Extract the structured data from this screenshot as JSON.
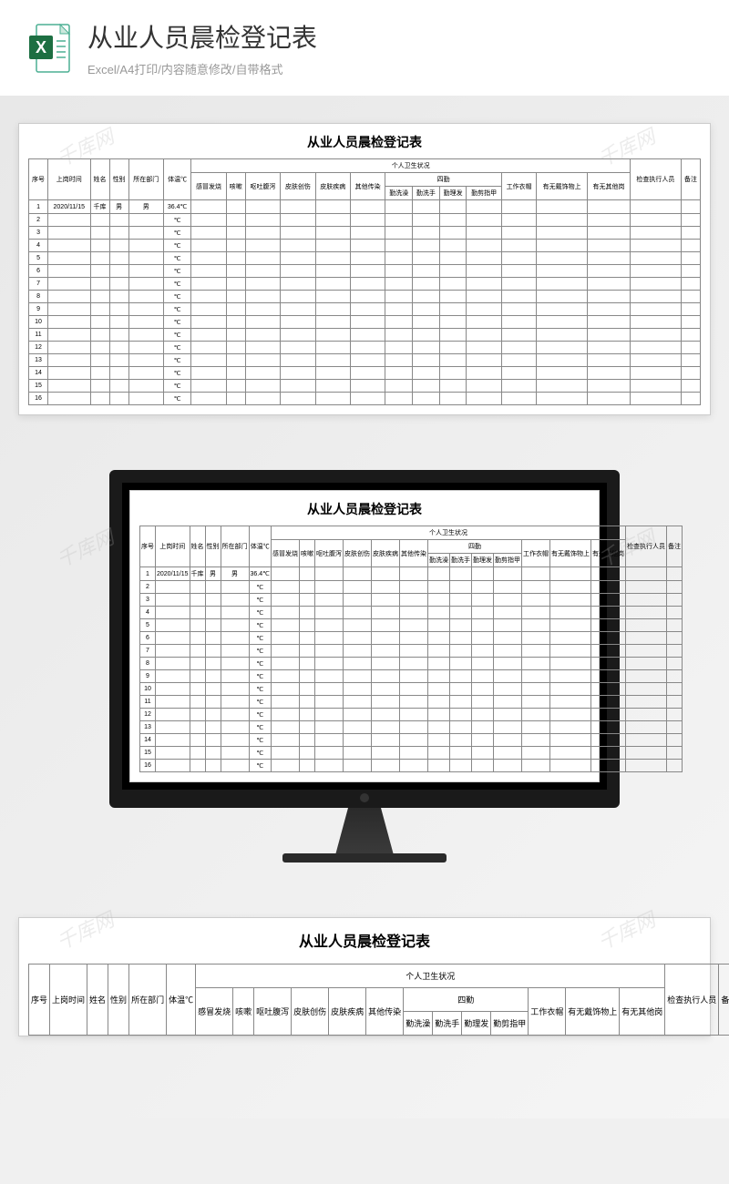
{
  "header": {
    "title": "从业人员晨检登记表",
    "subtitle": "Excel/A4打印/内容随意修改/自带格式"
  },
  "watermark": "千库网",
  "sheet": {
    "title": "从业人员晨检登记表",
    "group_header": "个人卫生状况",
    "sub_group": "四勤",
    "columns": {
      "seq": "序号",
      "date": "上岗时间",
      "name": "姓名",
      "gender": "性别",
      "dept": "所在部门",
      "temp": "体温℃",
      "cold": "感冒发烧",
      "cough": "咳嗽",
      "vomit": "呕吐腹泻",
      "wound": "皮肤创伤",
      "skin": "皮肤疾病",
      "other_inf": "其他传染",
      "bath": "勤洗澡",
      "wash": "勤洗手",
      "hair": "勤理发",
      "nail": "勤剪指甲",
      "uniform": "工作衣帽",
      "jewelry": "有无戴饰物上",
      "other_sit": "有无其他岗",
      "inspector": "检查执行人员",
      "remark": "备注"
    },
    "rows": [
      {
        "seq": "1",
        "date": "2020/11/15",
        "name": "千库",
        "gender": "男",
        "dept": "男",
        "temp": "36.4℃"
      },
      {
        "seq": "2",
        "date": "",
        "name": "",
        "gender": "",
        "dept": "",
        "temp": "℃"
      },
      {
        "seq": "3",
        "date": "",
        "name": "",
        "gender": "",
        "dept": "",
        "temp": "℃"
      },
      {
        "seq": "4",
        "date": "",
        "name": "",
        "gender": "",
        "dept": "",
        "temp": "℃"
      },
      {
        "seq": "5",
        "date": "",
        "name": "",
        "gender": "",
        "dept": "",
        "temp": "℃"
      },
      {
        "seq": "6",
        "date": "",
        "name": "",
        "gender": "",
        "dept": "",
        "temp": "℃"
      },
      {
        "seq": "7",
        "date": "",
        "name": "",
        "gender": "",
        "dept": "",
        "temp": "℃"
      },
      {
        "seq": "8",
        "date": "",
        "name": "",
        "gender": "",
        "dept": "",
        "temp": "℃"
      },
      {
        "seq": "9",
        "date": "",
        "name": "",
        "gender": "",
        "dept": "",
        "temp": "℃"
      },
      {
        "seq": "10",
        "date": "",
        "name": "",
        "gender": "",
        "dept": "",
        "temp": "℃"
      },
      {
        "seq": "11",
        "date": "",
        "name": "",
        "gender": "",
        "dept": "",
        "temp": "℃"
      },
      {
        "seq": "12",
        "date": "",
        "name": "",
        "gender": "",
        "dept": "",
        "temp": "℃"
      },
      {
        "seq": "13",
        "date": "",
        "name": "",
        "gender": "",
        "dept": "",
        "temp": "℃"
      },
      {
        "seq": "14",
        "date": "",
        "name": "",
        "gender": "",
        "dept": "",
        "temp": "℃"
      },
      {
        "seq": "15",
        "date": "",
        "name": "",
        "gender": "",
        "dept": "",
        "temp": "℃"
      },
      {
        "seq": "16",
        "date": "",
        "name": "",
        "gender": "",
        "dept": "",
        "temp": "℃"
      }
    ]
  }
}
